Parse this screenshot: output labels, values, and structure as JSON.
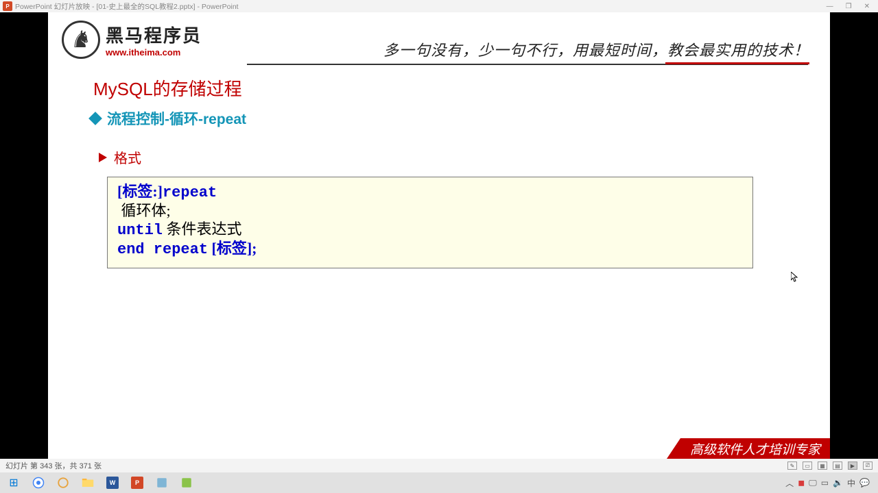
{
  "window": {
    "app_icon_label": "P",
    "title": "PowerPoint 幻灯片放映 - [01-史上最全的SQL教程2.pptx] - PowerPoint",
    "min": "—",
    "restore": "❐",
    "close": "✕"
  },
  "slide": {
    "logo_cn": "黑马程序员",
    "logo_url": "www.itheima.com",
    "slogan": "多一句没有，少一句不行，用最短时间，教会最实用的技术！",
    "title": "MySQL的存储过程",
    "section": "流程控制-循环-repeat",
    "format_label": "格式",
    "code": {
      "l1_bracket": "[标签:]",
      "l1_kw": "repeat",
      "l2": " 循环体;",
      "l3_kw": "until",
      "l3_rest": " 条件表达式",
      "l4_kw": "end repeat",
      "l4_rest": " [标签];"
    },
    "footer": "高级软件人才培训专家"
  },
  "statusbar": {
    "text": "幻灯片 第 343 张，共 371 张"
  },
  "taskbar": {
    "start": "⊞",
    "tray_up": "︿"
  }
}
